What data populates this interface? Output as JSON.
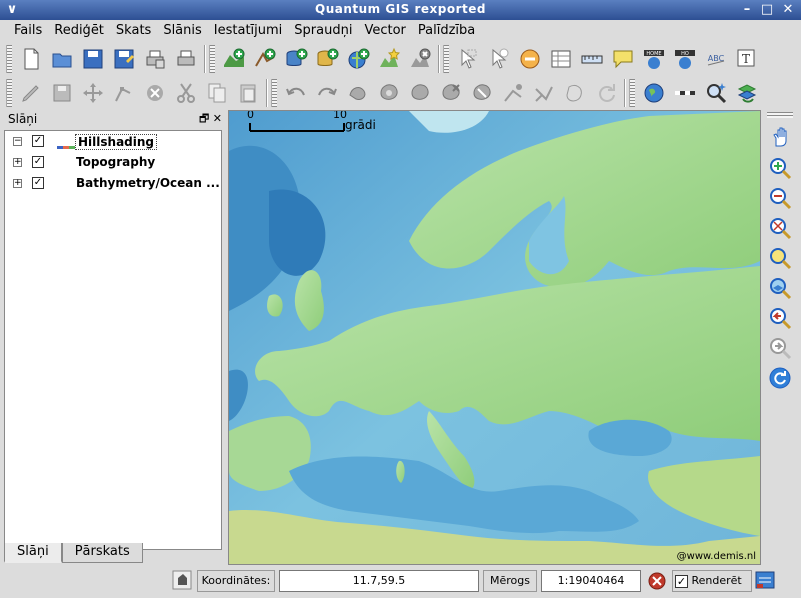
{
  "window": {
    "title": "Quantum GIS rexported"
  },
  "menu": {
    "items": [
      "Fails",
      "Rediģēt",
      "Skats",
      "Slānis",
      "Iestatījumi",
      "Spraudņi",
      "Vector",
      "Palīdzība"
    ]
  },
  "toolbar1": {
    "icons": [
      "new-project-icon",
      "open-project-icon",
      "save-project-icon",
      "save-as-icon",
      "print-composer-icon",
      "print-icon",
      "add-raster-icon",
      "add-vector-icon",
      "add-postgis-icon",
      "add-spatialite-icon",
      "add-wms-icon",
      "new-vector-layer-icon",
      "remove-layer-icon",
      "select-icon",
      "identify-icon",
      "measure-icon",
      "attribute-table-icon",
      "measure-line-icon",
      "map-tips-icon",
      "home-icon",
      "home-alt-icon",
      "label-icon",
      "annotation-icon"
    ]
  },
  "toolbar2": {
    "icons": [
      "edit-pencil-icon",
      "save-edits-icon",
      "move-feature-icon",
      "node-tool-icon",
      "delete-selected-icon",
      "cut-icon",
      "copy-icon",
      "paste-icon",
      "undo-icon",
      "redo-icon",
      "simplify-icon",
      "add-ring-icon",
      "add-part-icon",
      "delete-ring-icon",
      "delete-part-icon",
      "reshape-icon",
      "split-icon",
      "merge-icon",
      "rotate-icon",
      "globe-icon",
      "ruler-icon",
      "zoom-magic-icon",
      "refresh-layers-icon"
    ]
  },
  "layers_panel": {
    "title": "Slāņi",
    "layers": [
      {
        "name": "Hillshading",
        "checked": true,
        "selected": true
      },
      {
        "name": "Topography",
        "checked": true,
        "selected": false
      },
      {
        "name": "Bathymetry/Ocean ...",
        "checked": true,
        "selected": false
      }
    ],
    "tabs": [
      "Slāņi",
      "Pārskats"
    ]
  },
  "map": {
    "scale_zero": "0",
    "scale_ten": "10",
    "scale_unit": "grādi",
    "credit": "@www.demis.nl",
    "colors": {
      "sea": "#6fb5d9",
      "deep": "#3d8ec4",
      "land": "#9ed48a",
      "highland": "#d8cf8f"
    }
  },
  "right_tools": {
    "icons": [
      "pan-icon",
      "zoom-in-icon",
      "zoom-out-icon",
      "zoom-full-icon",
      "zoom-selection-icon",
      "zoom-layer-icon",
      "zoom-last-icon",
      "zoom-next-icon",
      "refresh-icon"
    ]
  },
  "status": {
    "coord_label": "Koordinātes:",
    "coord_value": "11.7,59.5",
    "scale_label": "Mērogs",
    "scale_value": "1:19040464",
    "render_label": "Renderēt",
    "render_checked": true
  }
}
